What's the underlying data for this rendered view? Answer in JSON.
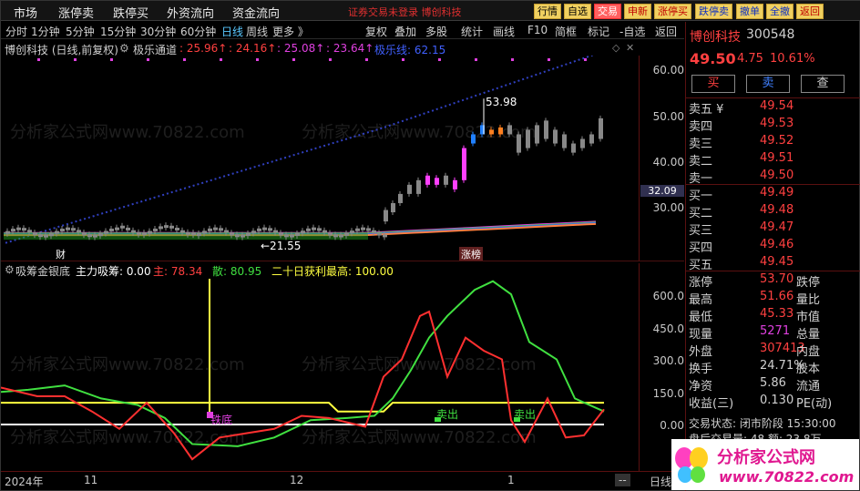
{
  "menu": {
    "items": [
      "市场",
      "涨停卖",
      "跌停买",
      "外资流向",
      "资金流向"
    ],
    "notice": "证券交易未登录  博创科技",
    "buttons": [
      "行情",
      "自选",
      "交易",
      "申新",
      "涨停买",
      "跌停卖",
      "撤单",
      "全撤",
      "返回"
    ]
  },
  "toolbar": {
    "periods": [
      "分时",
      "1分钟",
      "5分钟",
      "15分钟",
      "30分钟",
      "60分钟",
      "日线",
      "周线",
      "更多 》"
    ],
    "active": "日线",
    "tools": [
      "复权",
      "叠加",
      "多股",
      "统计",
      "画线",
      "F10",
      "简框",
      "标记",
      "-自选",
      "返回"
    ]
  },
  "infobar": {
    "stock": "博创科技 (日线,前复权)",
    "indicator": "极乐通道",
    "v1": ": 25.96↑",
    "v2": ": 24.16↑",
    "v3": ": 25.08↑",
    "v4": ": 23.64↑",
    "v5": "极乐线: 62.15"
  },
  "kline": {
    "high_marker": "53.98",
    "low_marker": "←21.55",
    "price_label": "32.09",
    "badge_cai": "财",
    "badge_zhang": "涨榜",
    "yticks": [
      "60.00",
      "50.00",
      "40.00",
      "30.00"
    ]
  },
  "indicator": {
    "name": "吸筹金银底",
    "main": "主力吸筹: 0.00",
    "zhu": "主: 78.34",
    "san": "散: 80.95",
    "profit": "二十日获利最高: 100.00",
    "yticks": [
      "600.0",
      "450.0",
      "300.0",
      "150.0",
      "0.00"
    ],
    "signals": [
      "铁底",
      "卖出",
      "卖出"
    ]
  },
  "xaxis": {
    "labels": [
      "2024年",
      "11",
      "12",
      "1",
      "--",
      "日线"
    ]
  },
  "quote": {
    "name": "博创科技",
    "code": "300548",
    "price": "49.50",
    "change": "4.75",
    "pct": "10.61%",
    "buttons": [
      "买",
      "卖",
      "查"
    ],
    "asks": [
      {
        "label": "卖五 ¥",
        "price": "49.54"
      },
      {
        "label": "卖四",
        "price": "49.53"
      },
      {
        "label": "卖三",
        "price": "49.52"
      },
      {
        "label": "卖二",
        "price": "49.51"
      },
      {
        "label": "卖一",
        "price": "49.50"
      }
    ],
    "bids": [
      {
        "label": "买一",
        "price": "49.49"
      },
      {
        "label": "买二",
        "price": "49.48"
      },
      {
        "label": "买三",
        "price": "49.47"
      },
      {
        "label": "买四",
        "price": "49.46"
      },
      {
        "label": "买五",
        "price": "49.45"
      }
    ],
    "stats": [
      {
        "l": "涨停",
        "v": "53.70",
        "l2": "跌停",
        "c": "#ff4040"
      },
      {
        "l": "最高",
        "v": "51.66",
        "l2": "量比",
        "c": "#ff4040"
      },
      {
        "l": "最低",
        "v": "45.33",
        "l2": "市值",
        "c": "#ff4040"
      },
      {
        "l": "现量",
        "v": "5271",
        "l2": "总量",
        "c": "#e040e0"
      },
      {
        "l": "外盘",
        "v": "307413",
        "l2": "内盘",
        "c": "#ff4040"
      },
      {
        "l": "换手",
        "v": "24.71%",
        "l2": "股本",
        "c": "#d0d0d0"
      },
      {
        "l": "净资",
        "v": "5.86",
        "l2": "流通",
        "c": "#d0d0d0"
      },
      {
        "l": "收益(三)",
        "v": "0.130",
        "l2": "PE(动)",
        "c": "#d0d0d0"
      }
    ],
    "status": "交易状态: 闭市阶段 15:30:00",
    "status2": "盘后交易量: 48   额: 23.8万"
  },
  "watermark": "分析家公式网www.70822.com",
  "logo": {
    "text": "分析家公式网",
    "url": "www.70822.com"
  },
  "colors": {
    "up": "#ff4040",
    "down": "#00c0c0",
    "yellow": "#ffff40",
    "green": "#40e040"
  }
}
